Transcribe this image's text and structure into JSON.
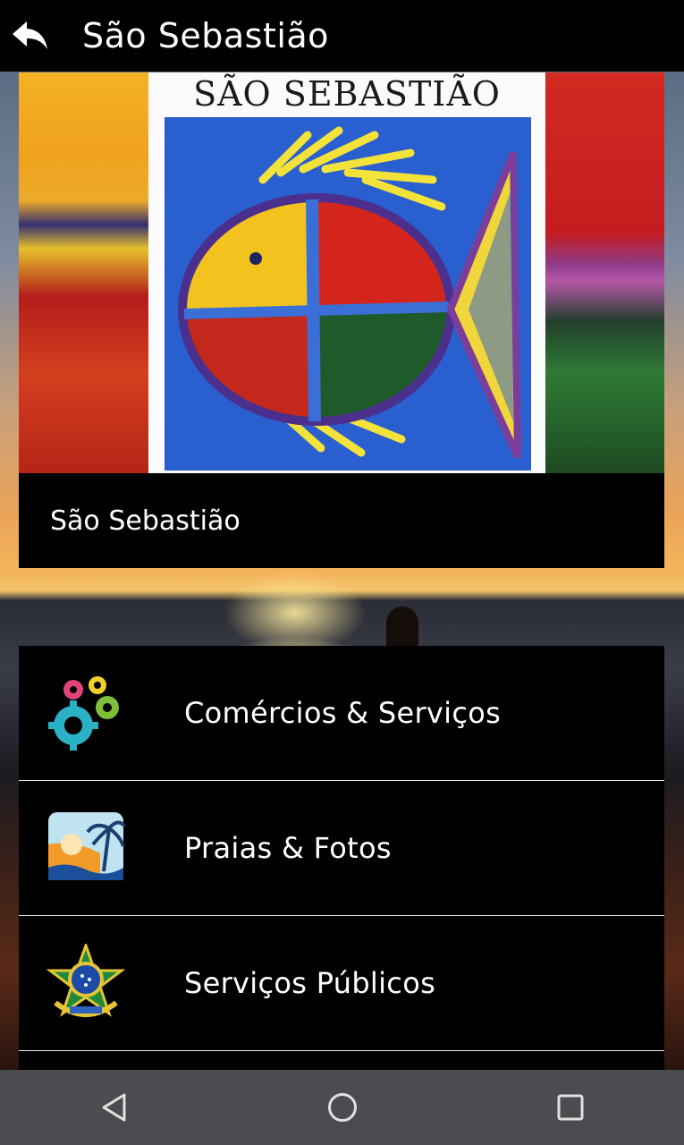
{
  "appbar": {
    "title": "São Sebastião",
    "back_icon": "back-arrow-icon"
  },
  "hero": {
    "poster_title": "SÃO SEBASTIÃO",
    "subtitle": "São Sebastião"
  },
  "menu": {
    "items": [
      {
        "label": "Comércios & Serviços",
        "icon": "gears-icon"
      },
      {
        "label": "Praias & Fotos",
        "icon": "beach-icon"
      },
      {
        "label": "Serviços Públicos",
        "icon": "coat-of-arms-icon"
      }
    ]
  },
  "navbar": {
    "back": "nav-back-icon",
    "home": "nav-home-icon",
    "recents": "nav-recents-icon"
  },
  "colors": {
    "appbar": "#000000",
    "text": "#ffffff",
    "navbar": "#4a4c50"
  }
}
